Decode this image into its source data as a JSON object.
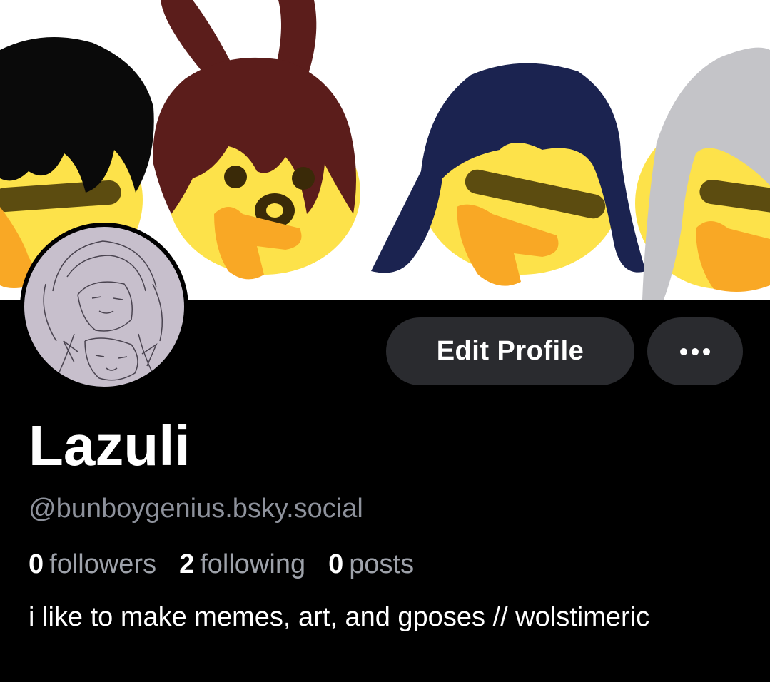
{
  "profile": {
    "display_name": "Lazuli",
    "handle": "@bunboygenius.bsky.social",
    "bio": "i like to make memes, art, and gposes // wolstimeric",
    "stats": [
      {
        "count": "0",
        "label": "followers"
      },
      {
        "count": "2",
        "label": "following"
      },
      {
        "count": "0",
        "label": "posts"
      }
    ]
  },
  "actions": {
    "edit_label": "Edit Profile",
    "more_icon": "ellipsis-icon"
  },
  "colors": {
    "background": "#000000",
    "button_bg": "#2a2b2f",
    "muted_text": "#8e929c",
    "emoji_yellow": "#fde24a",
    "hand_orange": "#f9a825"
  }
}
